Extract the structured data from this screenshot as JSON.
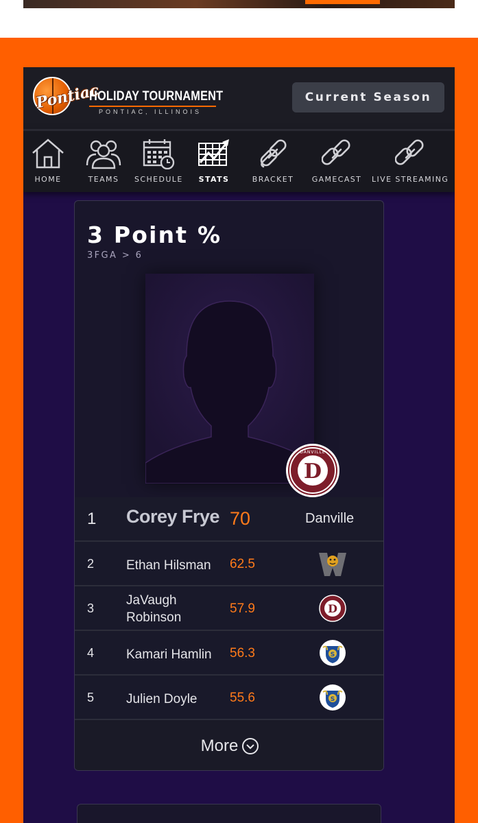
{
  "header": {
    "logo_script": "Pontiac",
    "logo_title": "HOLIDAY TOURNAMENT",
    "logo_subtitle": "PONTIAC, ILLINOIS",
    "season_button": "Current Season"
  },
  "nav": {
    "items": [
      {
        "label": "HOME",
        "icon": "home-icon"
      },
      {
        "label": "TEAMS",
        "icon": "users-icon"
      },
      {
        "label": "SCHEDULE",
        "icon": "calendar-icon"
      },
      {
        "label": "STATS",
        "icon": "chart-icon",
        "active": true
      },
      {
        "label": "BRACKET",
        "icon": "link-icon"
      },
      {
        "label": "GAMECAST",
        "icon": "link-icon"
      },
      {
        "label": "LIVE STREAMING",
        "icon": "link-icon"
      }
    ]
  },
  "stat_card": {
    "title": "3 Point %",
    "subtitle": "3FGA > 6",
    "badge_text": "DANVILLE HIGH SCHOOL",
    "leader": {
      "rank": "1",
      "name": "Corey Frye",
      "value": "70",
      "team": "Danville"
    },
    "rows": [
      {
        "rank": "2",
        "name": "Ethan Hilsman",
        "value": "62.5",
        "team_icon": "tiger-w-logo-icon"
      },
      {
        "rank": "3",
        "name": "JaVaugh Robinson",
        "value": "57.9",
        "team_icon": "danville-d-logo-icon"
      },
      {
        "rank": "4",
        "name": "Kamari Hamlin",
        "value": "56.3",
        "team_icon": "s-crest-logo-icon"
      },
      {
        "rank": "5",
        "name": "Julien Doyle",
        "value": "55.6",
        "team_icon": "s-crest-logo-icon"
      }
    ],
    "more_label": "More"
  },
  "colors": {
    "accent": "#ff5f00",
    "stat_value": "#ff7a1a",
    "background": "#1f0d46"
  }
}
